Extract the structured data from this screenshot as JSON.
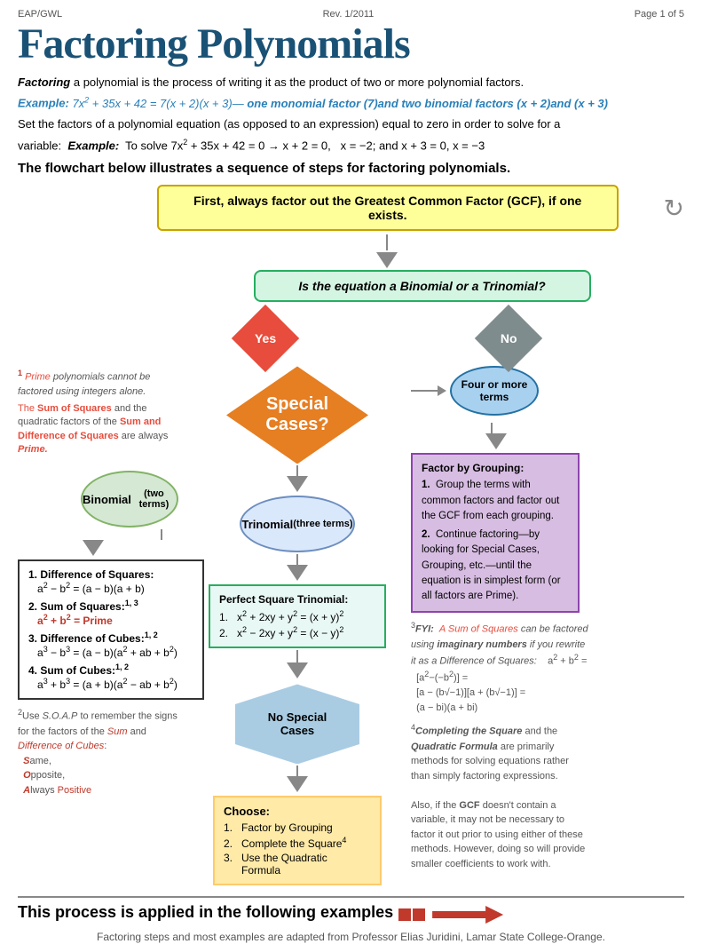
{
  "header": {
    "left": "EAP/GWL",
    "center": "Rev. 1/2011",
    "right": "Page 1 of 5"
  },
  "title": "Factoring Polynomials",
  "intro": {
    "line1_bold": "Factoring",
    "line1_rest": " a polynomial is the process of writing it as the product of two or more polynomial factors.",
    "line2": "Example: 7x² + 35x + 42 = 7(x + 2)(x + 3)— one monomial factor (7)and two binomial factors (x + 2)and (x + 3)",
    "line3": "Set the factors of a polynomial equation (as opposed to an expression) equal to zero in order to solve for a",
    "line4": "variable:",
    "line4_example": "Example: To solve 7x² + 35x + 42 = 0 → x + 2 = 0,  x = −2; and x + 3 = 0,  x = −3"
  },
  "flowchart_title": "The flowchart below illustrates a sequence of steps for factoring polynomials.",
  "gcf_box": "First, always factor out the Greatest Common Factor (GCF), if one exists.",
  "question_box": "Is the equation a Binomial or a Trinomial?",
  "yes_label": "Yes",
  "no_label": "No",
  "special_cases": "Special Cases?",
  "binomial_oval": "Binomial\n(two terms)",
  "trinomial_oval": "Trinomial\n(three terms)",
  "four_more": "Four or more\nterms",
  "left_box": {
    "items": [
      {
        "num": "1.",
        "title": "Difference of Squares:",
        "formula": "a² − b² = (a − b)(a + b)"
      },
      {
        "num": "2.",
        "title": "Sum of Squares:",
        "sup": "1, 3",
        "formula": "a² + b² = Prime",
        "formula_color": "red"
      },
      {
        "num": "3.",
        "title": "Difference of Cubes:",
        "sup": "1, 2",
        "formula": "a³ − b³ = (a − b)(a² + ab + b²)"
      },
      {
        "num": "4.",
        "title": "Sum of Cubes:",
        "sup": "1, 2",
        "formula": "a³ + b³ = (a + b)(a² − ab + b²)"
      }
    ]
  },
  "perfect_square_box": {
    "title": "Perfect Square Trinomial:",
    "items": [
      "1.  x² + 2xy + y² = (x + y)²",
      "2.  x² − 2xy + y² = (x − y)²"
    ]
  },
  "grouping_box": {
    "title": "Factor by Grouping:",
    "items": [
      "1.  Group the terms with common factors and factor out the GCF from each grouping.",
      "2.  Continue factoring—by looking for Special Cases, Grouping, etc.—until the equation is in simplest form (or all factors are Prime)."
    ]
  },
  "no_special_label": "No Special\nCases",
  "choose_box": {
    "title": "Choose:",
    "items": [
      "1.  Factor by Grouping",
      "2.  Complete the Square⁴",
      "3.  Use the Quadratic Formula"
    ]
  },
  "note1": {
    "sup": "1",
    "text": "Prime polynomials cannot be factored using integers alone."
  },
  "note_sum_diff": {
    "title": "The Sum of Squares",
    "rest1": " and the quadratic factors of the ",
    "title2": "Sum and Difference of Squares",
    "rest2": " are always ",
    "prime": "Prime."
  },
  "note2": {
    "sup": "2",
    "text1": "Use S.O.A.P to remember the signs for the factors of the ",
    "sum": "Sum",
    "and": " and ",
    "diff": "Difference",
    "cubes": " of Cubes:",
    "same": "Same,",
    "opp": "Opposite,",
    "always": "Always Positive"
  },
  "note3_fyi": {
    "sup": "3",
    "text": "FYI:  A Sum of Squares can be factored using imaginary numbers if you rewrite it as a Difference of Squares:",
    "formula": "a² + b² = [a² − (−b²)] = [a − (b√−1)][a + (b√−1)] = (a − bi)(a + bi)"
  },
  "note4": {
    "sup": "4",
    "text1": "Completing the Square",
    "text2": " and the ",
    "text3": "Quadratic Formula",
    "text4": " are primarily methods for solving equations rather than simply factoring expressions.",
    "text5": "Also, if the GCF doesn't contain a variable, it may not be necessary to factor it out prior to using either of these methods. However, doing so will provide smaller coefficients to work with."
  },
  "more_terms_label": "more terms",
  "bottom_section": {
    "title": "This process is applied in the following examples",
    "note": "Factoring steps and most examples are adapted from Professor Elias Juridini, Lamar State College-Orange."
  }
}
